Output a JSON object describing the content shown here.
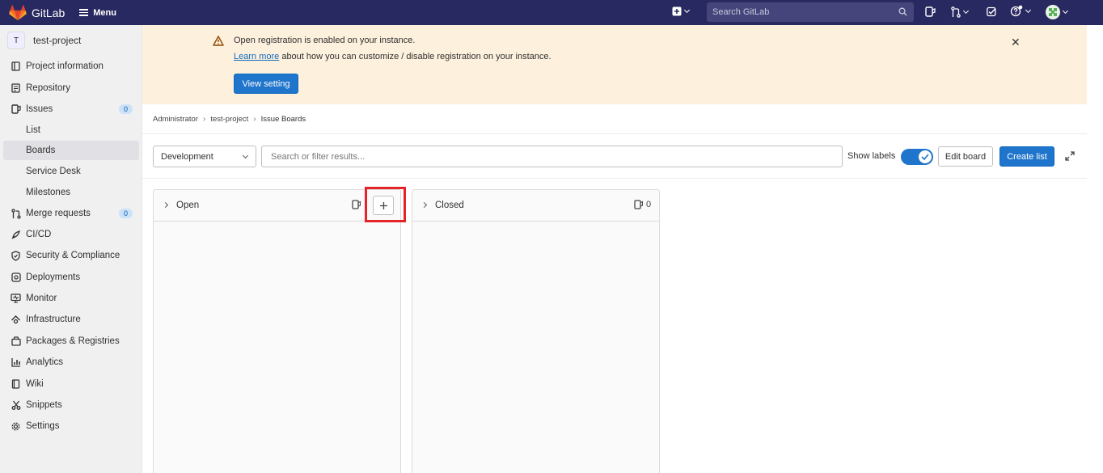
{
  "navbar": {
    "brand": "GitLab",
    "menu_label": "Menu",
    "search_placeholder": "Search GitLab"
  },
  "sidebar": {
    "project_initial": "T",
    "project_name": "test-project",
    "items": [
      {
        "label": "Project information",
        "icon": "info-icon"
      },
      {
        "label": "Repository",
        "icon": "repository-icon"
      },
      {
        "label": "Issues",
        "icon": "issues-icon",
        "badge": "0"
      },
      {
        "label": "List",
        "sub": true
      },
      {
        "label": "Boards",
        "sub": true,
        "active": true
      },
      {
        "label": "Service Desk",
        "sub": true
      },
      {
        "label": "Milestones",
        "sub": true
      },
      {
        "label": "Merge requests",
        "icon": "merge-request-icon",
        "badge": "0"
      },
      {
        "label": "CI/CD",
        "icon": "rocket-icon"
      },
      {
        "label": "Security & Compliance",
        "icon": "shield-icon"
      },
      {
        "label": "Deployments",
        "icon": "deployments-icon"
      },
      {
        "label": "Monitor",
        "icon": "monitor-icon"
      },
      {
        "label": "Infrastructure",
        "icon": "cloud-icon"
      },
      {
        "label": "Packages & Registries",
        "icon": "package-icon"
      },
      {
        "label": "Analytics",
        "icon": "chart-icon"
      },
      {
        "label": "Wiki",
        "icon": "book-icon"
      },
      {
        "label": "Snippets",
        "icon": "scissors-icon"
      },
      {
        "label": "Settings",
        "icon": "gear-icon"
      }
    ]
  },
  "banner": {
    "title": "Open registration is enabled on your instance.",
    "learn_more": "Learn more",
    "body": " about how you can customize / disable registration on your instance.",
    "button": "View setting"
  },
  "breadcrumb": [
    "Administrator",
    "test-project",
    "Issue Boards"
  ],
  "filters": {
    "board_name": "Development",
    "search_placeholder": "Search or filter results...",
    "show_labels": "Show labels",
    "show_labels_on": true,
    "edit_board": "Edit board",
    "create_list": "Create list"
  },
  "lists": [
    {
      "title": "Open",
      "count": ""
    },
    {
      "title": "Closed",
      "count": "0"
    }
  ],
  "colors": {
    "navbar": "#292961",
    "primary": "#1f75cb",
    "banner_bg": "#fdf1dd",
    "highlight": "#e5242a"
  }
}
